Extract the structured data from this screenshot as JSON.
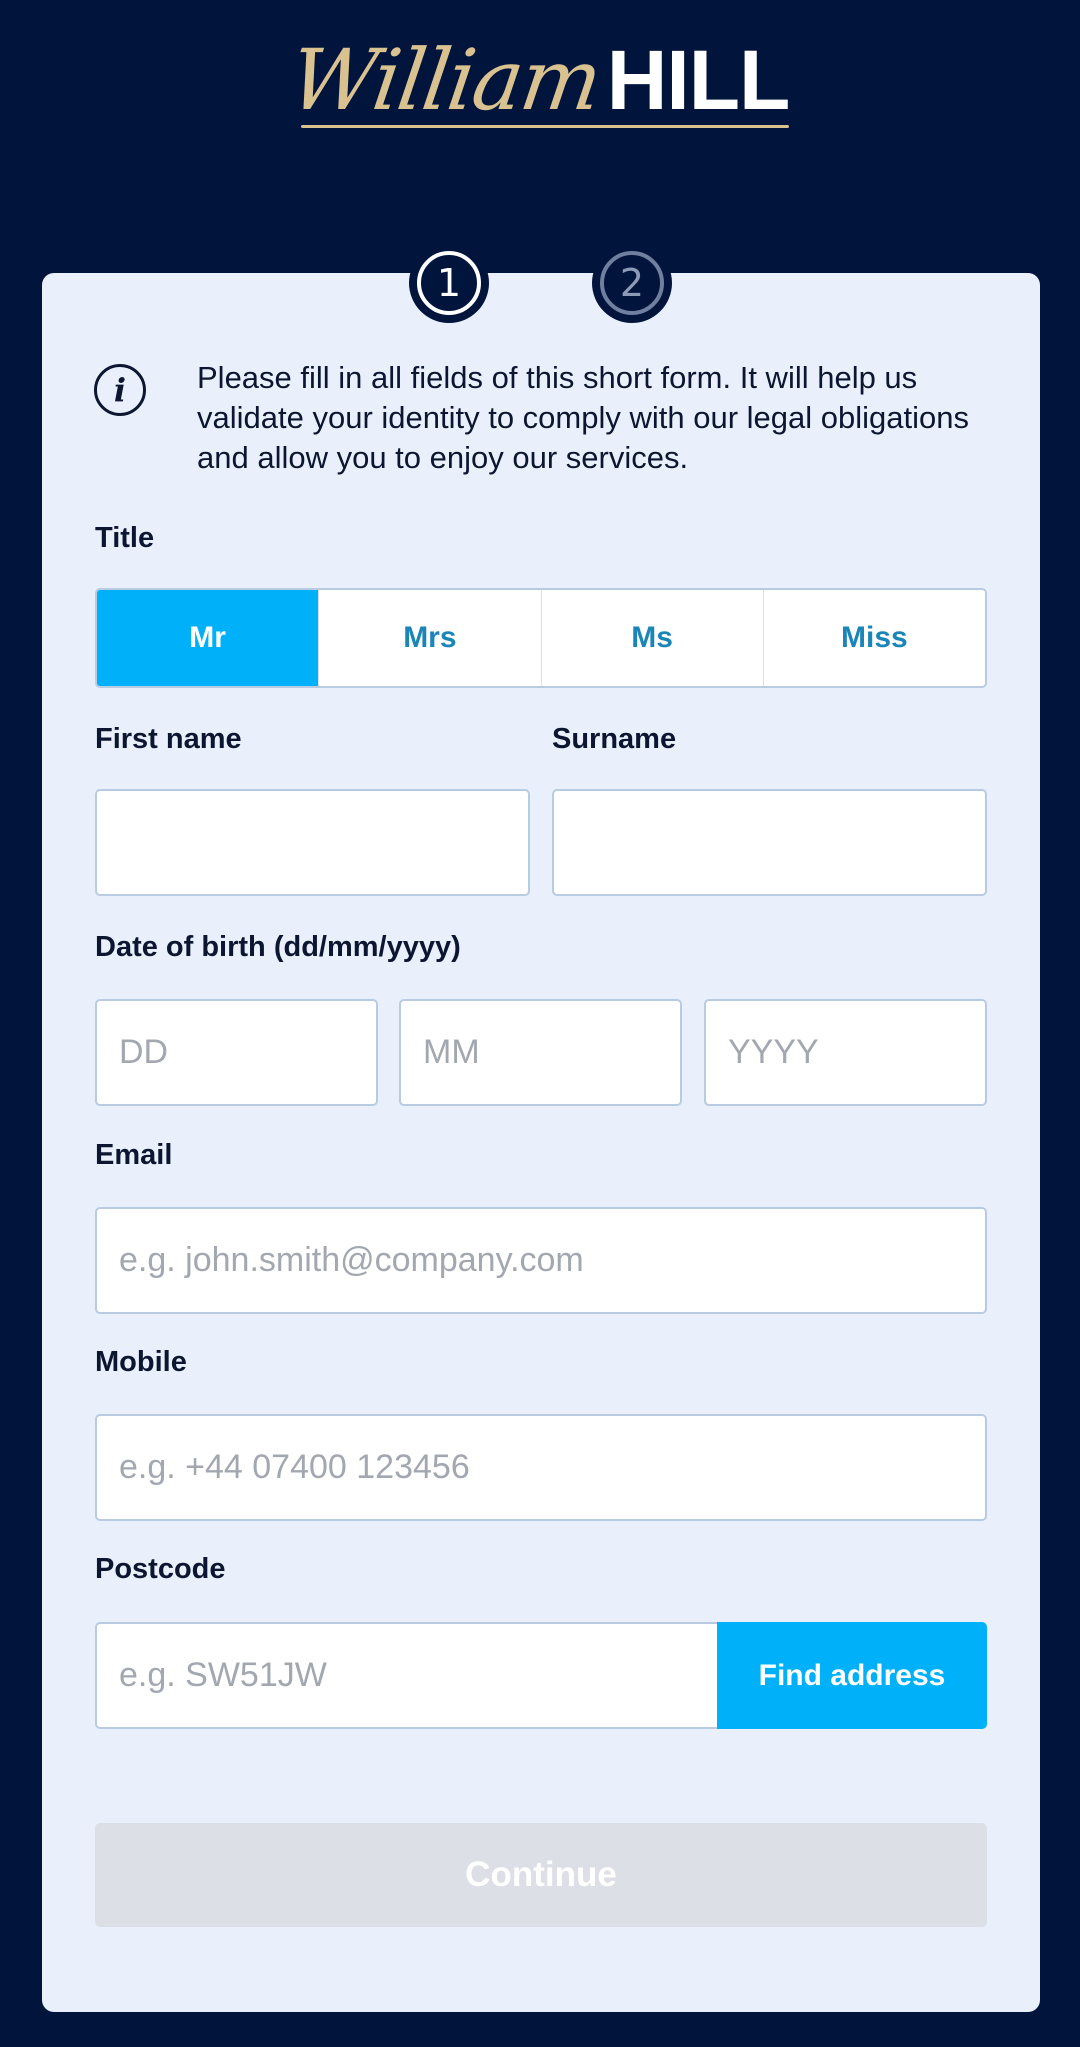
{
  "logo": {
    "script": "William",
    "bold": "HILL"
  },
  "steps": [
    "1",
    "2"
  ],
  "info": {
    "icon": "info-icon",
    "glyph": "i",
    "text": "Please fill in all fields of this short form. It will help us validate your identity to comply with our legal obligations and allow you to enjoy our services."
  },
  "title": {
    "label": "Title",
    "options": [
      "Mr",
      "Mrs",
      "Ms",
      "Miss"
    ],
    "selected": "Mr"
  },
  "first_name": {
    "label": "First name",
    "value": "",
    "placeholder": ""
  },
  "surname": {
    "label": "Surname",
    "value": "",
    "placeholder": ""
  },
  "dob": {
    "label": "Date of birth (dd/mm/yyyy)",
    "day_placeholder": "DD",
    "month_placeholder": "MM",
    "year_placeholder": "YYYY"
  },
  "email": {
    "label": "Email",
    "placeholder": "e.g. john.smith@company.com"
  },
  "mobile": {
    "label": "Mobile",
    "placeholder": "e.g. +44 07400 123456"
  },
  "postcode": {
    "label": "Postcode",
    "placeholder": "e.g. SW51JW",
    "find_label": "Find address"
  },
  "continue_label": "Continue",
  "colors": {
    "background": "#00143c",
    "card": "#e9f0fc",
    "accent": "#00b1f9",
    "gold": "#d9c290",
    "disabled": "#dcdfe5"
  }
}
